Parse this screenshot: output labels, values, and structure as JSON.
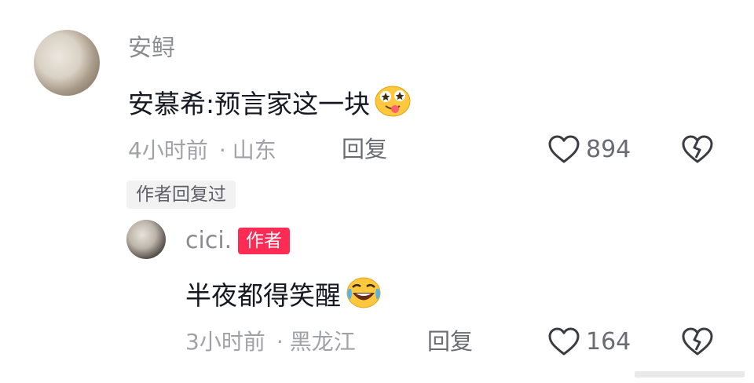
{
  "comments": [
    {
      "username": "安鲟",
      "text": "安慕希:预言家这一块",
      "emoji": "starry-eyed-tongue-emoji",
      "time": "4小时前",
      "separator": "·",
      "location": "山东",
      "reply_label": "回复",
      "likes": "894"
    }
  ],
  "author_replied_tag": "作者回复过",
  "reply": {
    "username": "cici.",
    "badge": "作者",
    "text": "半夜都得笑醒",
    "emoji": "rolling-on-floor-laughing-emoji",
    "time": "3小时前",
    "separator": "·",
    "location": "黑龙江",
    "reply_label": "回复",
    "likes": "164"
  },
  "colors": {
    "badge": "#fe2c55",
    "text": "#161823",
    "meta": "#a1a2a7"
  }
}
